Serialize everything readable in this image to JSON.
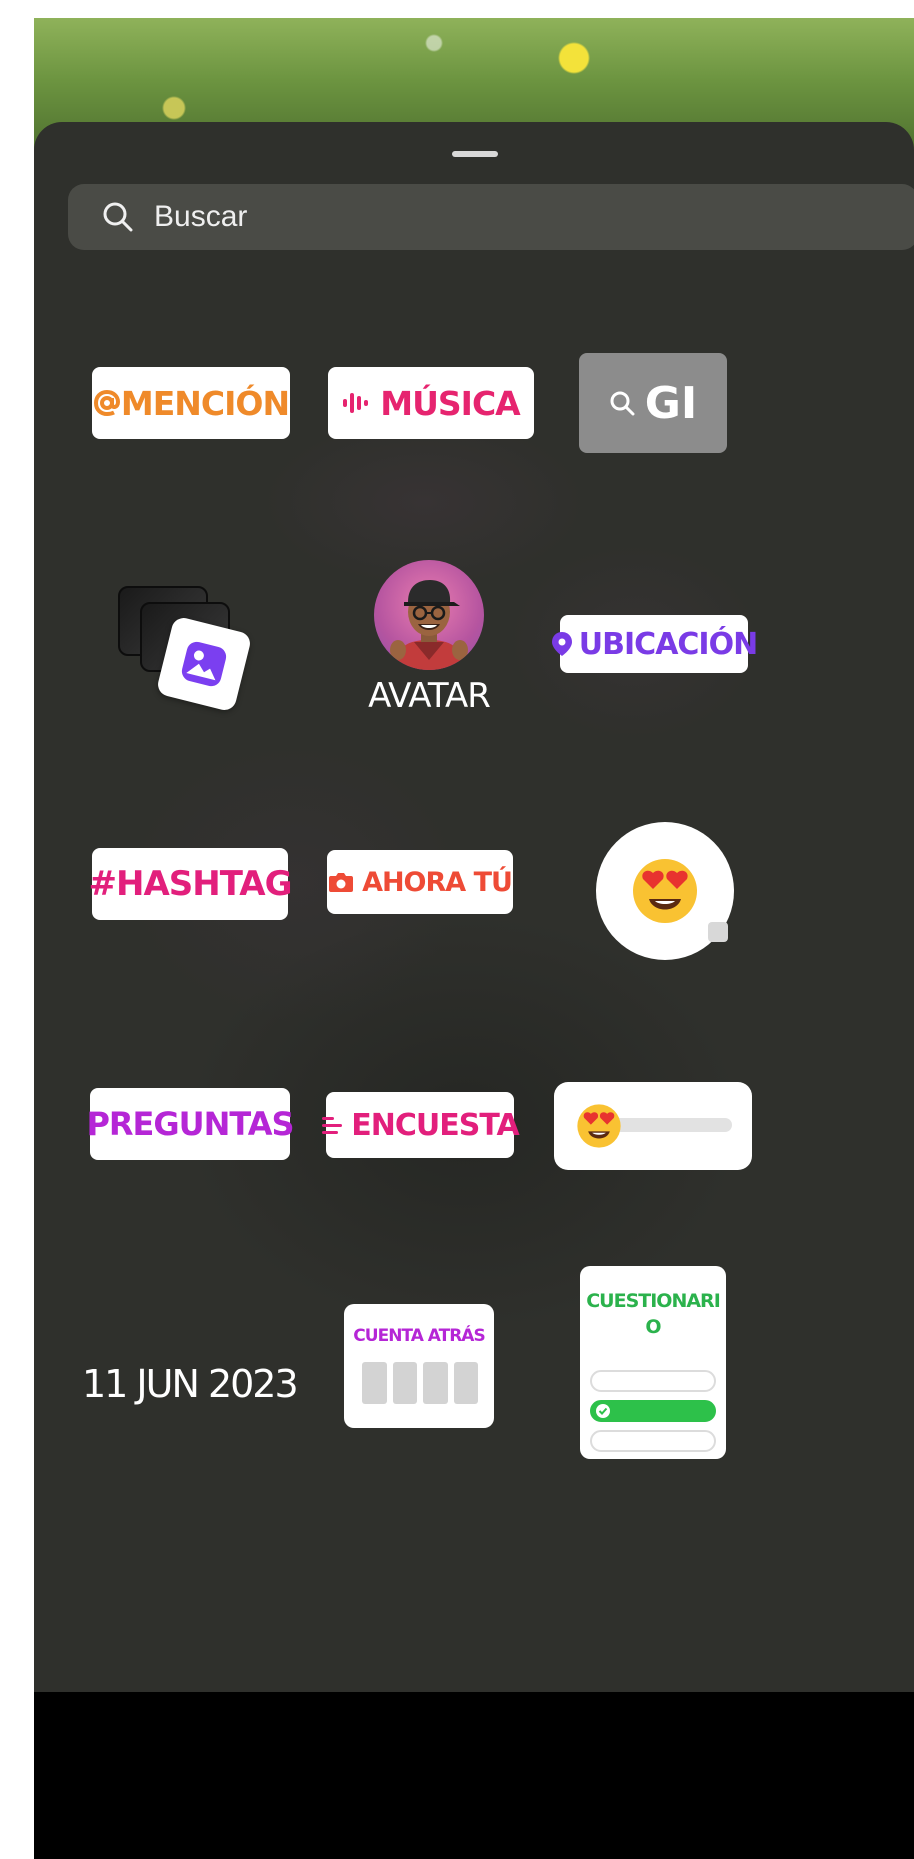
{
  "search": {
    "placeholder": "Buscar",
    "icon": "search-icon"
  },
  "stickers": {
    "mention": "MENCIÓN",
    "music": "MÚSICA",
    "gif": "GI",
    "avatar": "AVATAR",
    "location": "UBICACIÓN",
    "hashtag": "#HASHTAG",
    "add_yours": "AHORA TÚ",
    "questions": "PREGUNTAS",
    "poll": "ENCUESTA",
    "date": "11 JUN 2023",
    "countdown": "CUENTA ATRÁS",
    "quiz": "CUESTIONARIO"
  },
  "colors": {
    "sheet": "#2f302c",
    "mention": "#ef8a2a",
    "music": "#e6246f",
    "location": "#7a3be6",
    "hashtag": "#e21f7c",
    "add_yours": "#ee4b36",
    "questions": "#b526d6",
    "quiz": "#2bb24c"
  }
}
